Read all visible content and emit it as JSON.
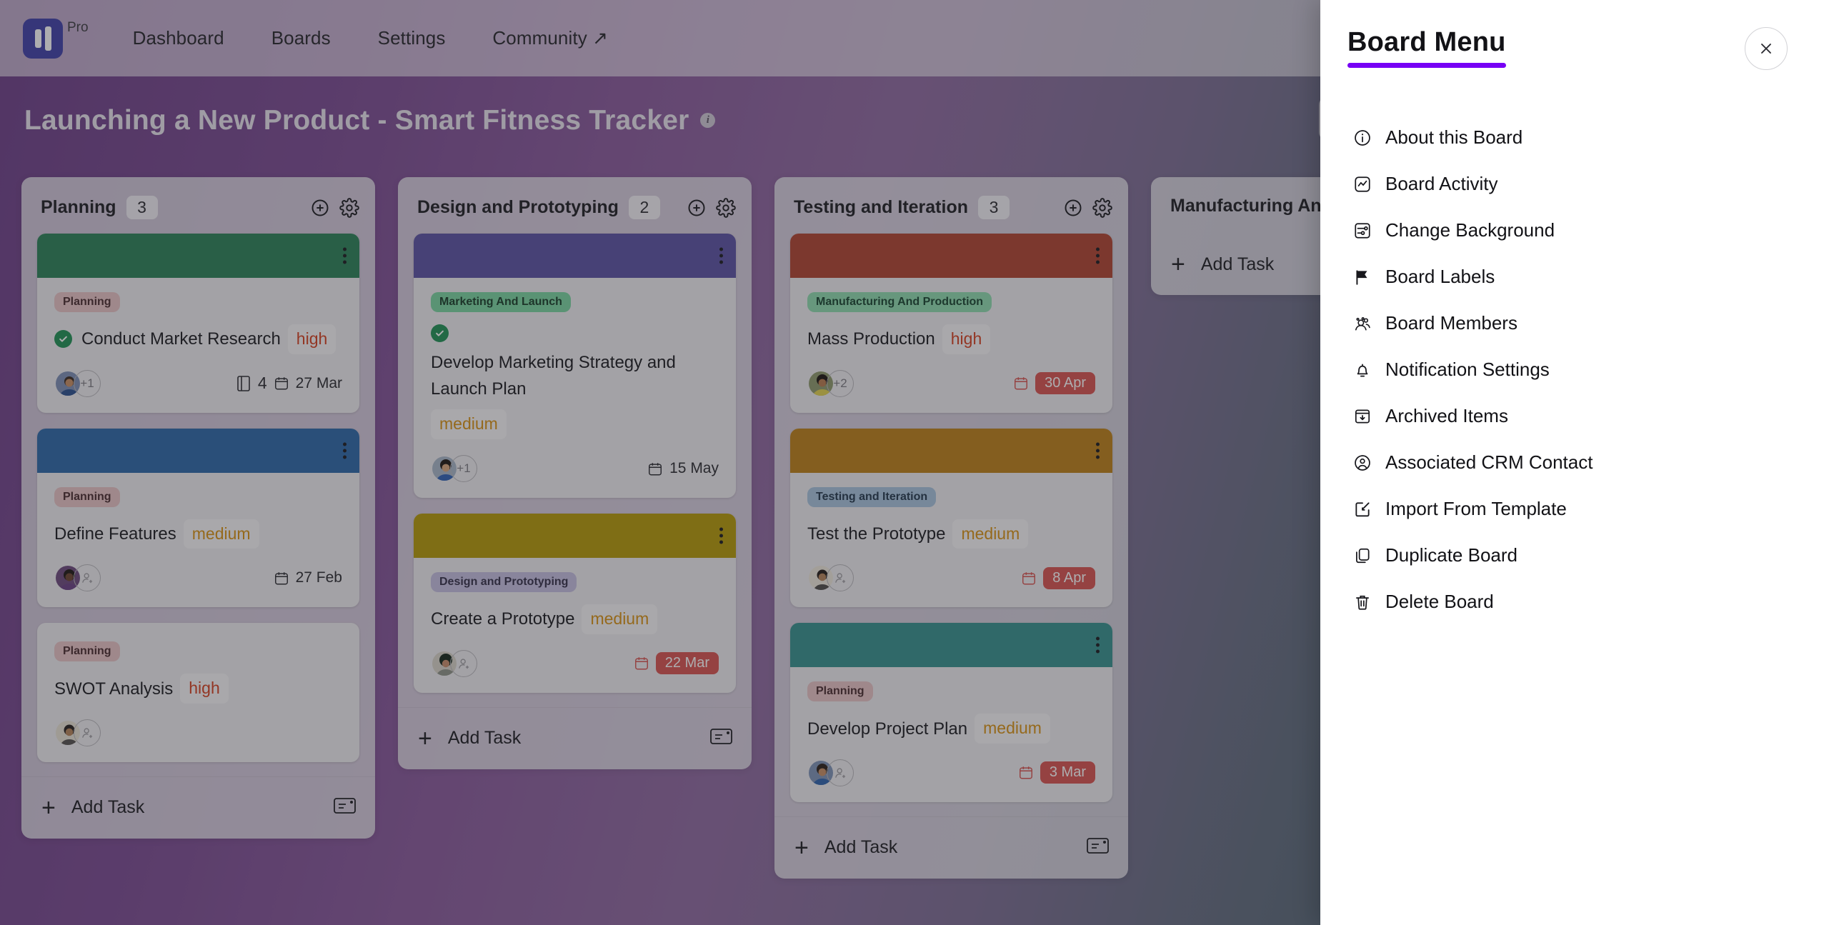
{
  "topnav": {
    "brand_badge": "Pro",
    "items": [
      {
        "label": "Dashboard",
        "external": false
      },
      {
        "label": "Boards",
        "external": false
      },
      {
        "label": "Settings",
        "external": false
      },
      {
        "label": "Community ↗",
        "external": true
      }
    ]
  },
  "board": {
    "title": "Launching a New Product - Smart Fitness Tracker",
    "info_icon": "info-icon",
    "view_toggle_icon": "board-view-icon"
  },
  "colors": {
    "accent": "#7700f5",
    "overdue": "#d9534f",
    "priority_high": "#d6401f",
    "priority_medium": "#d99212",
    "check_green": "#1f9254"
  },
  "add_task_label": "Add Task",
  "columns": [
    {
      "title": "Planning",
      "count": "3",
      "cards": [
        {
          "cover": "#2a8257",
          "tag": "Planning",
          "tag_style": "planning",
          "title": "Conduct Market Research",
          "completed": true,
          "priority": "high",
          "priority_style": "high",
          "avatars": 1,
          "avatar_extra": "+1",
          "attachments": "4",
          "date": "27 Mar",
          "overdue": false
        },
        {
          "cover": "#2d68a8",
          "tag": "Planning",
          "tag_style": "planning",
          "title": "Define Features",
          "completed": false,
          "priority": "medium",
          "priority_style": "medium",
          "avatars": 1,
          "avatar_extra": "",
          "attachments": "",
          "date": "27 Feb",
          "overdue": false
        },
        {
          "cover": "",
          "tag": "Planning",
          "tag_style": "planning",
          "title": "SWOT Analysis",
          "completed": false,
          "priority": "high",
          "priority_style": "high",
          "avatars": 1,
          "avatar_extra": "",
          "attachments": "",
          "date": "",
          "overdue": false
        }
      ]
    },
    {
      "title": "Design and Prototyping",
      "count": "2",
      "cards": [
        {
          "cover": "#5b52a3",
          "tag": "Marketing And Launch",
          "tag_style": "marketing",
          "title": "Develop Marketing Strategy and Launch Plan",
          "completed": true,
          "priority": "medium",
          "priority_style": "medium",
          "avatars": 1,
          "avatar_extra": "+1",
          "attachments": "",
          "date": "15 May",
          "overdue": false
        },
        {
          "cover": "#b59a08",
          "tag": "Design and Prototyping",
          "tag_style": "design",
          "title": "Create a Prototype",
          "completed": false,
          "priority": "medium",
          "priority_style": "medium",
          "avatars": 1,
          "avatar_extra": "",
          "attachments": "",
          "date": "22 Mar",
          "overdue": true
        }
      ]
    },
    {
      "title": "Testing and Iteration",
      "count": "3",
      "cards": [
        {
          "cover": "#b1432f",
          "tag": "Manufacturing And Production",
          "tag_style": "manufacturing",
          "title": "Mass Production",
          "completed": false,
          "priority": "high",
          "priority_style": "high",
          "avatars": 1,
          "avatar_extra": "+2",
          "attachments": "",
          "date": "30 Apr",
          "overdue": true
        },
        {
          "cover": "#bd8018",
          "tag": "Testing and Iteration",
          "tag_style": "testing",
          "title": "Test the Prototype",
          "completed": false,
          "priority": "medium",
          "priority_style": "medium",
          "avatars": 1,
          "avatar_extra": "",
          "attachments": "",
          "date": "8 Apr",
          "overdue": true
        },
        {
          "cover": "#36918f",
          "tag": "Planning",
          "tag_style": "planning",
          "title": "Develop Project Plan",
          "completed": false,
          "priority": "medium",
          "priority_style": "medium",
          "avatars": 1,
          "avatar_extra": "",
          "attachments": "",
          "date": "3 Mar",
          "overdue": true
        }
      ]
    },
    {
      "title": "Manufacturing And Production",
      "count": "",
      "cards": []
    }
  ],
  "drawer": {
    "title": "Board Menu",
    "close_icon": "close-icon",
    "items": [
      {
        "label": "About this Board",
        "icon": "info-circle-icon"
      },
      {
        "label": "Board Activity",
        "icon": "activity-icon"
      },
      {
        "label": "Change Background",
        "icon": "sliders-icon"
      },
      {
        "label": "Board Labels",
        "icon": "flag-icon"
      },
      {
        "label": "Board Members",
        "icon": "users-icon"
      },
      {
        "label": "Notification Settings",
        "icon": "bell-icon"
      },
      {
        "label": "Archived Items",
        "icon": "archive-icon"
      },
      {
        "label": "Associated CRM Contact",
        "icon": "user-circle-icon"
      },
      {
        "label": "Import From Template",
        "icon": "import-icon"
      },
      {
        "label": "Duplicate Board",
        "icon": "copy-icon"
      },
      {
        "label": "Delete Board",
        "icon": "trash-icon"
      }
    ]
  }
}
